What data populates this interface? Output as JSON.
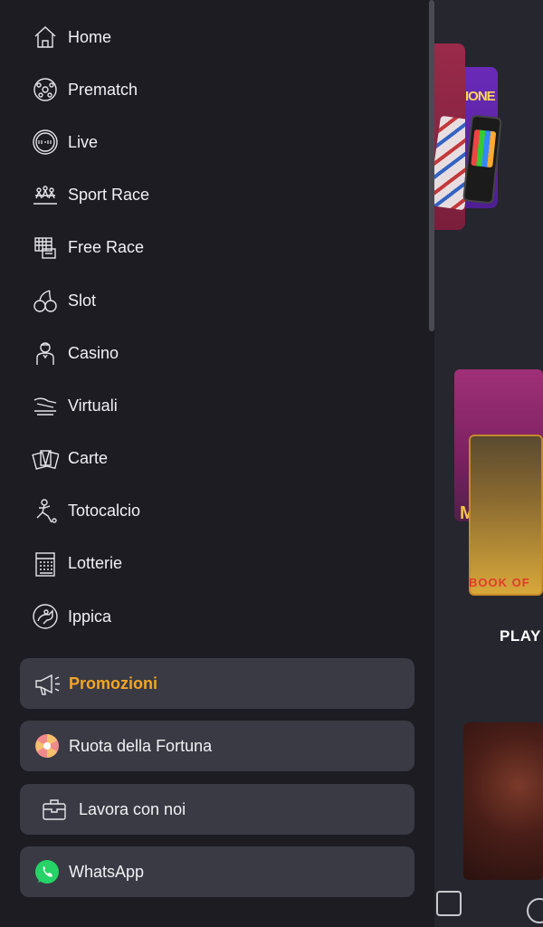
{
  "menu": {
    "items": [
      {
        "label": "Home",
        "icon": "home-icon"
      },
      {
        "label": "Prematch",
        "icon": "soccer-ball-icon"
      },
      {
        "label": "Live",
        "icon": "live-timer-icon"
      },
      {
        "label": "Sport Race",
        "icon": "sport-race-icon"
      },
      {
        "label": "Free Race",
        "icon": "free-race-icon"
      },
      {
        "label": "Slot",
        "icon": "cherry-icon"
      },
      {
        "label": "Casino",
        "icon": "croupier-icon"
      },
      {
        "label": "Virtuali",
        "icon": "virtual-icon"
      },
      {
        "label": "Carte",
        "icon": "cards-icon"
      },
      {
        "label": "Totocalcio",
        "icon": "player-kick-icon"
      },
      {
        "label": "Lotterie",
        "icon": "lotto-ticket-icon"
      },
      {
        "label": "Ippica",
        "icon": "horse-icon"
      }
    ]
  },
  "cards": {
    "promozioni": {
      "label": "Promozioni",
      "icon": "megaphone-icon",
      "color": "#f5a524"
    },
    "ruota": {
      "label": "Ruota della Fortuna",
      "icon": "wheel-icon"
    },
    "lavora": {
      "label": "Lavora con noi",
      "icon": "briefcase-icon"
    },
    "whatsapp": {
      "label": "WhatsApp",
      "icon": "whatsapp-icon",
      "color": "#25d366"
    }
  },
  "background": {
    "promo_text": "IONE",
    "game_text_1": "M",
    "game_text_2": "BOOK OF",
    "section_label": "PLAY"
  },
  "colors": {
    "drawer_bg": "#1c1c22",
    "card_bg": "#3a3a44",
    "accent": "#f5a524"
  }
}
